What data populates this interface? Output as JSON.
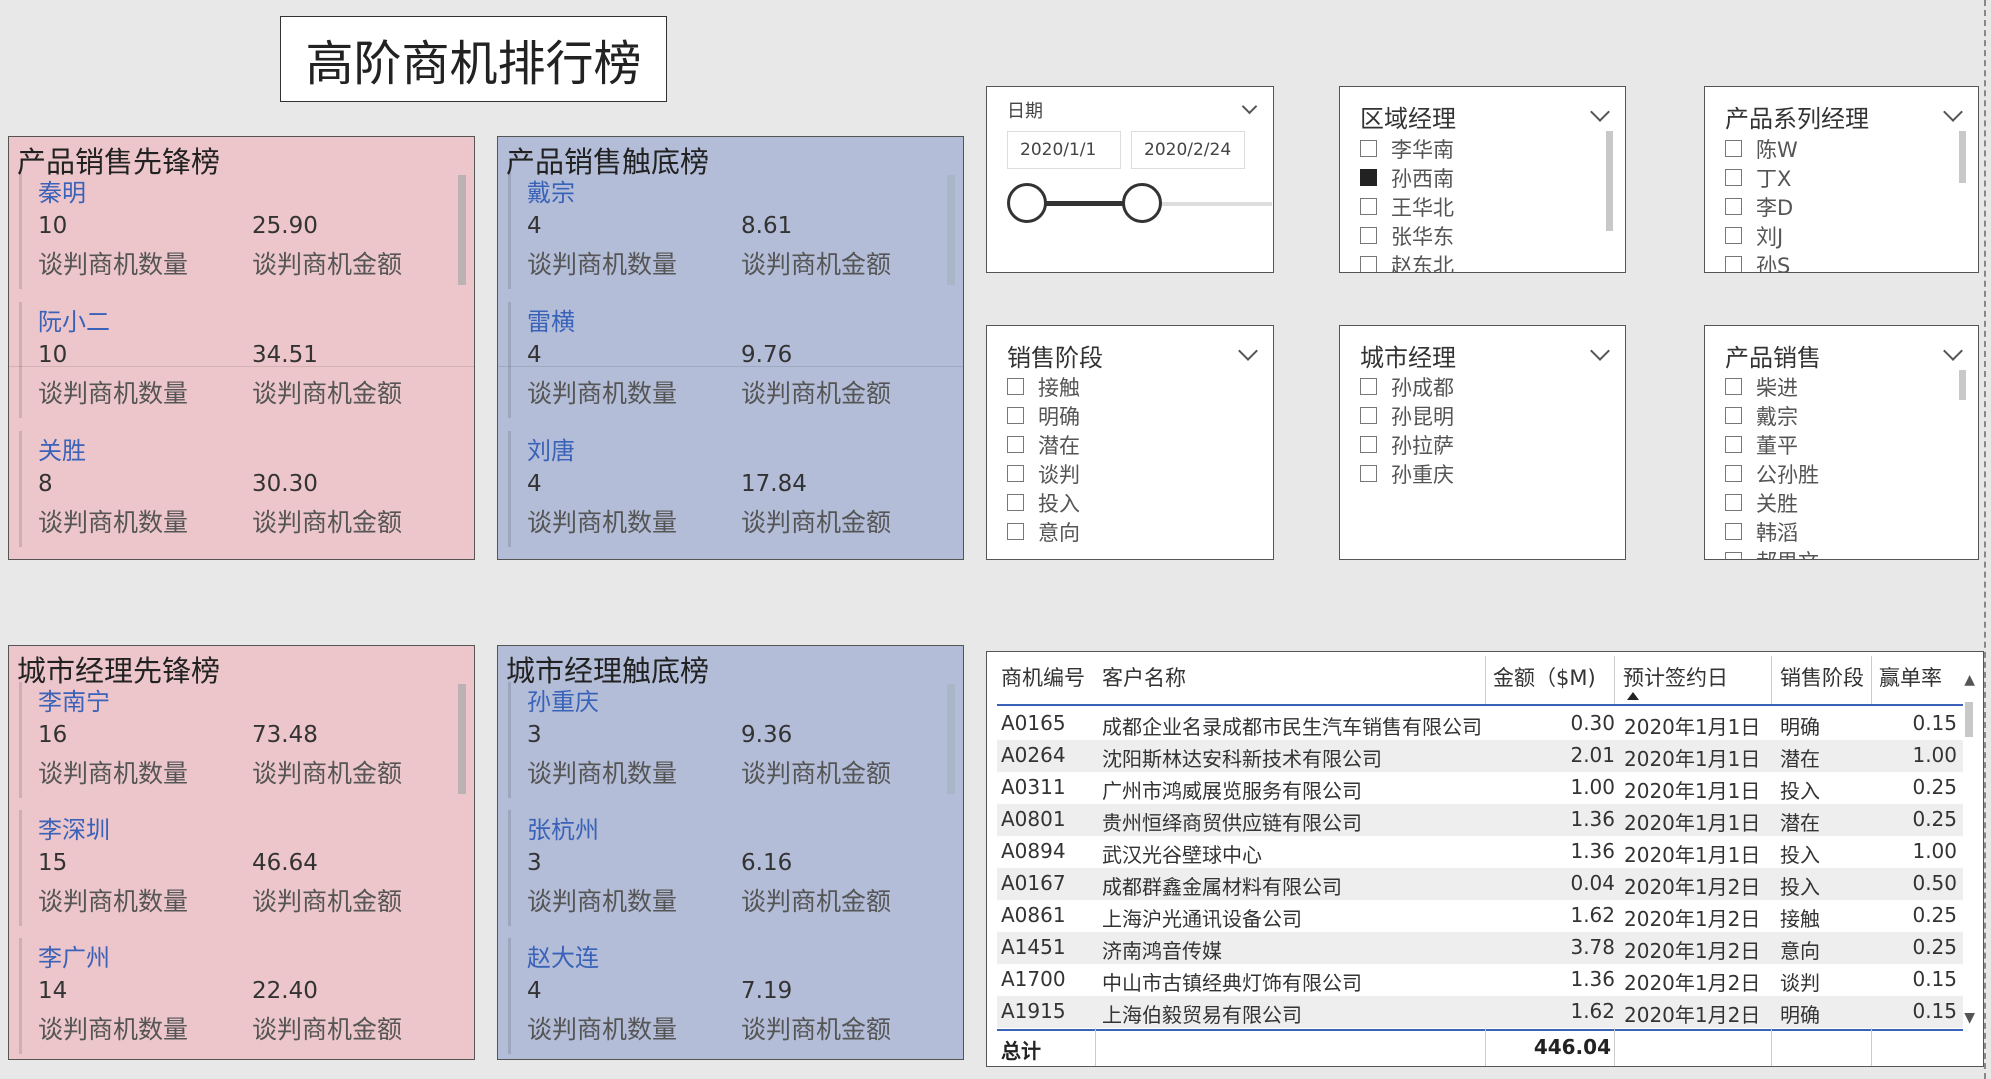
{
  "title": "高阶商机排行榜",
  "labels": {
    "count": "谈判商机数量",
    "amount": "谈判商机金额"
  },
  "cards": [
    {
      "title": "产品销售先锋榜",
      "entries": [
        {
          "name": "秦明",
          "count": "10",
          "amount": "25.90"
        },
        {
          "name": "阮小二",
          "count": "10",
          "amount": "34.51"
        },
        {
          "name": "关胜",
          "count": "8",
          "amount": "30.30"
        }
      ]
    },
    {
      "title": "产品销售触底榜",
      "entries": [
        {
          "name": "戴宗",
          "count": "4",
          "amount": "8.61"
        },
        {
          "name": "雷横",
          "count": "4",
          "amount": "9.76"
        },
        {
          "name": "刘唐",
          "count": "4",
          "amount": "17.84"
        }
      ]
    },
    {
      "title": "城市经理先锋榜",
      "entries": [
        {
          "name": "李南宁",
          "count": "16",
          "amount": "73.48"
        },
        {
          "name": "李深圳",
          "count": "15",
          "amount": "46.64"
        },
        {
          "name": "李广州",
          "count": "14",
          "amount": "22.40"
        }
      ]
    },
    {
      "title": "城市经理触底榜",
      "entries": [
        {
          "name": "孙重庆",
          "count": "3",
          "amount": "9.36"
        },
        {
          "name": "张杭州",
          "count": "3",
          "amount": "6.16"
        },
        {
          "name": "赵大连",
          "count": "4",
          "amount": "7.19"
        }
      ]
    }
  ],
  "date_slicer": {
    "title": "日期",
    "start": "2020/1/1",
    "end": "2020/2/24",
    "range_fraction": [
      0.0,
      0.47
    ]
  },
  "slicers": {
    "region": {
      "title": "区域经理",
      "items": [
        "李华南",
        "孙西南",
        "王华北",
        "张华东",
        "赵东北"
      ],
      "checked": "孙西南"
    },
    "series": {
      "title": "产品系列经理",
      "items": [
        "陈W",
        "丁X",
        "李D",
        "刘J",
        "孙S"
      ]
    },
    "stage": {
      "title": "销售阶段",
      "items": [
        "接触",
        "明确",
        "潜在",
        "谈判",
        "投入",
        "意向"
      ]
    },
    "city": {
      "title": "城市经理",
      "items": [
        "孙成都",
        "孙昆明",
        "孙拉萨",
        "孙重庆"
      ]
    },
    "product": {
      "title": "产品销售",
      "items": [
        "柴进",
        "戴宗",
        "董平",
        "公孙胜",
        "关胜",
        "韩滔",
        "郝思文"
      ]
    }
  },
  "table": {
    "headers": [
      "商机编号",
      "客户名称",
      "金额（$M)",
      "预计签约日",
      "销售阶段",
      "赢单率"
    ],
    "rows": [
      [
        "A0165",
        "成都企业名录成都市民生汽车销售有限公司",
        "0.30",
        "2020年1月1日",
        "明确",
        "0.15"
      ],
      [
        "A0264",
        "沈阳斯林达安科新技术有限公司",
        "2.01",
        "2020年1月1日",
        "潜在",
        "1.00"
      ],
      [
        "A0311",
        "广州市鸿威展览服务有限公司",
        "1.00",
        "2020年1月1日",
        "投入",
        "0.25"
      ],
      [
        "A0801",
        "贵州恒绎商贸供应链有限公司",
        "1.36",
        "2020年1月1日",
        "潜在",
        "0.25"
      ],
      [
        "A0894",
        "武汉光谷壁球中心",
        "1.36",
        "2020年1月1日",
        "投入",
        "1.00"
      ],
      [
        "A0167",
        "成都群鑫金属材料有限公司",
        "0.04",
        "2020年1月2日",
        "投入",
        "0.50"
      ],
      [
        "A0861",
        "上海沪光通讯设备公司",
        "1.62",
        "2020年1月2日",
        "接触",
        "0.25"
      ],
      [
        "A1451",
        "济南鸿音传媒",
        "3.78",
        "2020年1月2日",
        "意向",
        "0.25"
      ],
      [
        "A1700",
        "中山市古镇经典灯饰有限公司",
        "1.36",
        "2020年1月2日",
        "谈判",
        "0.15"
      ],
      [
        "A1915",
        "上海伯毅贸易有限公司",
        "1.62",
        "2020年1月2日",
        "明确",
        "0.15"
      ]
    ],
    "total_label": "总计",
    "total_value": "446.04"
  }
}
